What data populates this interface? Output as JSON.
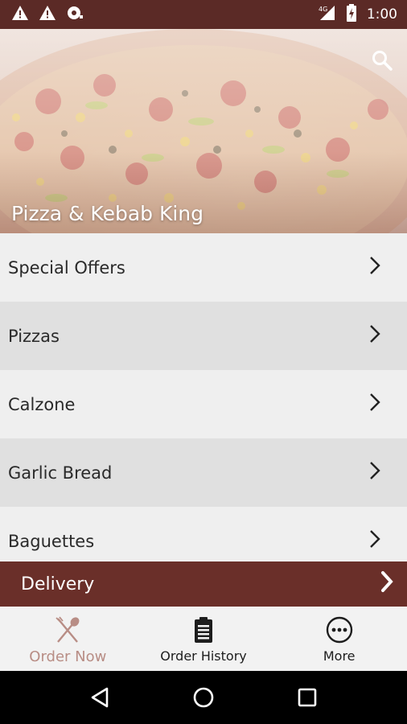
{
  "status_bar": {
    "time": "1:00",
    "network": "4G",
    "icons": [
      "warning-icon",
      "warning-icon",
      "camera-icon",
      "signal-icon",
      "battery-icon"
    ]
  },
  "hero": {
    "title": "Pizza & Kebab King",
    "search_icon": "search-icon"
  },
  "menu": {
    "items": [
      {
        "label": "Special Offers"
      },
      {
        "label": "Pizzas"
      },
      {
        "label": "Calzone"
      },
      {
        "label": "Garlic Bread"
      },
      {
        "label": "Baguettes"
      }
    ]
  },
  "delivery": {
    "label": "Delivery"
  },
  "tabs": [
    {
      "label": "Order Now",
      "icon": "fork-spoon-icon",
      "active": true
    },
    {
      "label": "Order History",
      "icon": "clipboard-icon",
      "active": false
    },
    {
      "label": "More",
      "icon": "more-icon",
      "active": false
    }
  ],
  "colors": {
    "brand": "#6a2f29",
    "status_bar": "#5b2a26",
    "active_tab": "#b88d85"
  }
}
